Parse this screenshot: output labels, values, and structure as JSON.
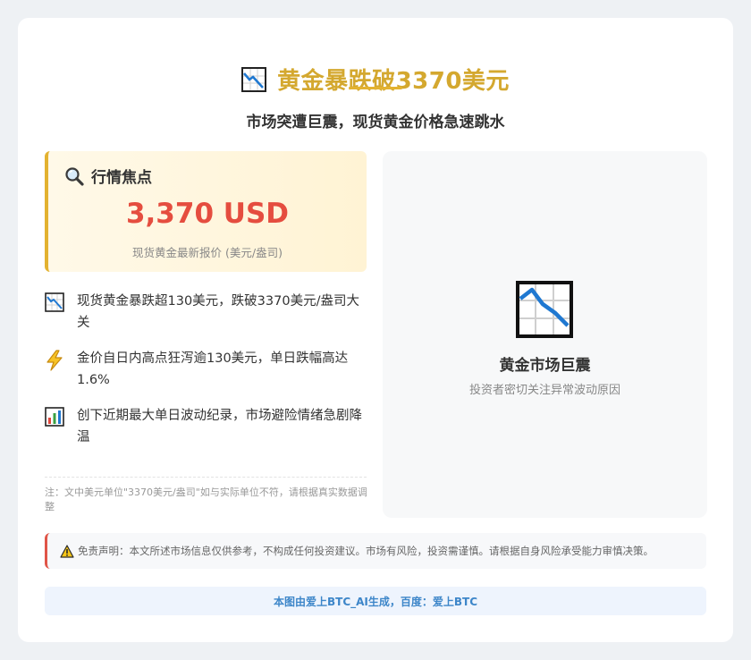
{
  "header": {
    "icon": "chart-decreasing-icon",
    "title": "黄金暴跌破3370美元",
    "subtitle": "市场突遭巨震，现货黄金价格急速跳水"
  },
  "focus": {
    "icon": "magnifier-icon",
    "label": "行情焦点",
    "price": "3,370 USD",
    "caption": "现货黄金最新报价 (美元/盎司)"
  },
  "bullets": [
    {
      "icon": "chart-decreasing-icon",
      "text": "现货黄金暴跌超130美元，跌破3370美元/盎司大关"
    },
    {
      "icon": "lightning-icon",
      "text": "金价自日内高点狂泻逾130美元，单日跌幅高达1.6%"
    },
    {
      "icon": "bar-chart-icon",
      "text": "创下近期最大单日波动纪录，市场避险情绪急剧降温"
    }
  ],
  "note": "注：文中美元单位\"3370美元/盎司\"如与实际单位不符，请根据真实数据调整",
  "panel": {
    "icon": "chart-decreasing-icon",
    "title": "黄金市场巨震",
    "subtitle": "投资者密切关注异常波动原因"
  },
  "disclaimer": {
    "icon": "warning-icon",
    "text": "免责声明：本文所述市场信息仅供参考，不构成任何投资建议。市场有风险，投资需谨慎。请根据自身风险承受能力审慎决策。"
  },
  "footer": {
    "text": "本图由爱上BTC_AI生成，百度：爱上BTC"
  },
  "colors": {
    "title": "#d4a82f",
    "price": "#e54d3f",
    "accent_border": "#e3b230",
    "disclaimer_border": "#e05548",
    "footer_text": "#3d86c9"
  }
}
